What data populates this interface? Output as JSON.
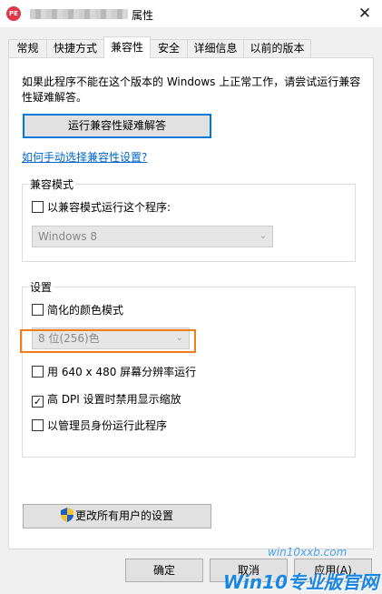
{
  "window": {
    "app_icon_text": "PE",
    "title": "属性",
    "close_symbol": "✕"
  },
  "tabs": [
    {
      "label": "常规"
    },
    {
      "label": "快捷方式"
    },
    {
      "label": "兼容性"
    },
    {
      "label": "安全"
    },
    {
      "label": "详细信息"
    },
    {
      "label": "以前的版本"
    }
  ],
  "compat": {
    "description": "如果此程序不能在这个版本的 Windows 上正常工作，请尝试运行兼容性疑难解答。",
    "troubleshoot_button": "运行兼容性疑难解答",
    "manual_link": "如何手动选择兼容性设置?"
  },
  "compat_mode": {
    "group_label": "兼容模式",
    "checkbox_label": "以兼容模式运行这个程序:",
    "checked": false,
    "os_select_value": "Windows 8"
  },
  "settings": {
    "group_label": "设置",
    "reduced_color": {
      "label": "简化的颜色模式",
      "checked": false
    },
    "color_select_value": "8 位(256)色",
    "res_640": {
      "label": "用 640 x 480 屏幕分辨率运行",
      "checked": false
    },
    "high_dpi": {
      "label": "高 DPI 设置时禁用显示缩放",
      "checked": true
    },
    "run_admin": {
      "label": "以管理员身份运行此程序",
      "checked": false
    }
  },
  "change_all_users_button": "更改所有用户的设置",
  "footer": {
    "ok": "确定",
    "cancel": "取消",
    "apply": "应用(A)"
  },
  "watermark": {
    "url": "win10xxb.com",
    "brand": "Win10专业版官网"
  },
  "colors": {
    "accent_blue": "#0078d7",
    "highlight_orange": "#f07e1b",
    "link_blue": "#0066cc"
  },
  "icons": {
    "close": "close-icon",
    "shield": "uac-shield-icon",
    "dropdown": "chevron-down-icon",
    "check": "checkmark-icon"
  }
}
